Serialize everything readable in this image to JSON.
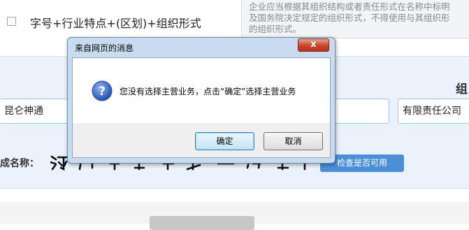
{
  "top": {
    "format_option": "字号+行业特点+(区划)+组织形式",
    "note": "企业应当根据其组织结构或者责任形式在名称中标明\n及国务院决定规定的组织形式，不得使用与其组织形\n的组织形式。"
  },
  "form": {
    "org_label": "组",
    "trade_name_value": "昆仑神通",
    "org_type_value": "有限责任公司",
    "name_label": "成名称：",
    "check_button": "检查是否可用"
  },
  "dialog": {
    "title": "来自网页的消息",
    "close_label": "x",
    "message": "您没有选择主营业务，点击“确定”选择主营业务",
    "ok_label": "确定",
    "cancel_label": "取消"
  },
  "icons": {
    "dialog_icon": "info-question-icon",
    "close_icon": "close-icon"
  },
  "colors": {
    "section_bg": "#eaf3fb",
    "primary_button": "#4a8fd8",
    "close_button": "#c7442b"
  }
}
